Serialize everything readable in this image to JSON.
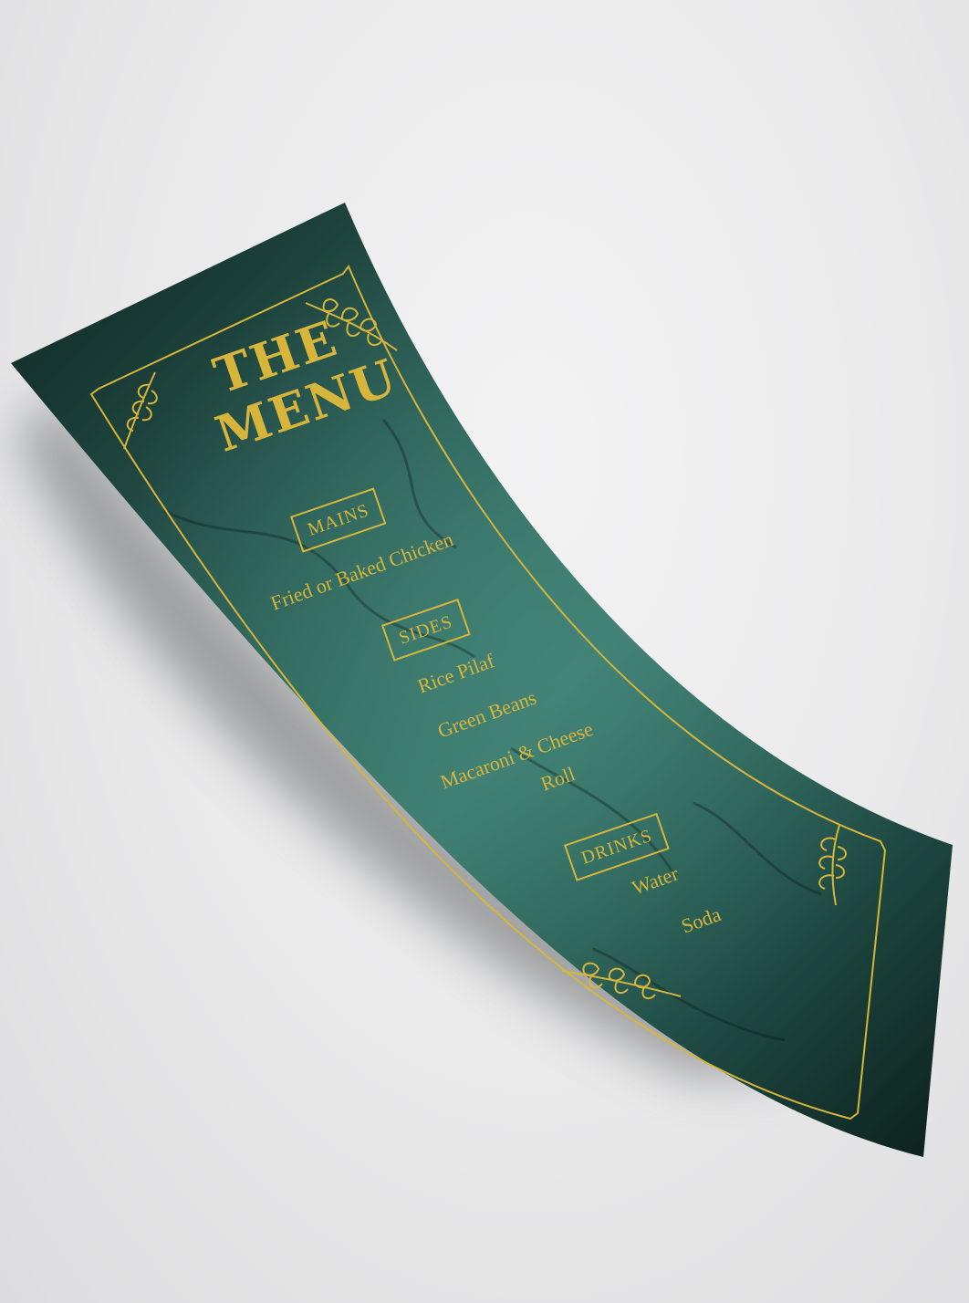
{
  "menu": {
    "title_line1": "THE",
    "title_line2": "MENU",
    "sections": [
      {
        "label": "MAINS",
        "items": [
          "Fried or Baked Chicken"
        ]
      },
      {
        "label": "SIDES",
        "items": [
          "Rice Pilaf",
          "Green Beans",
          "Macaroni & Cheese",
          "Roll"
        ]
      },
      {
        "label": "DRINKS",
        "items": [
          "Water",
          "Soda"
        ]
      }
    ]
  },
  "colors": {
    "background": "#e9e9ea",
    "card_dark": "#0f2a25",
    "card_mid": "#2f6a5f",
    "gold": "#d7b53a"
  },
  "icons": [
    "leaf-branch-icon"
  ]
}
